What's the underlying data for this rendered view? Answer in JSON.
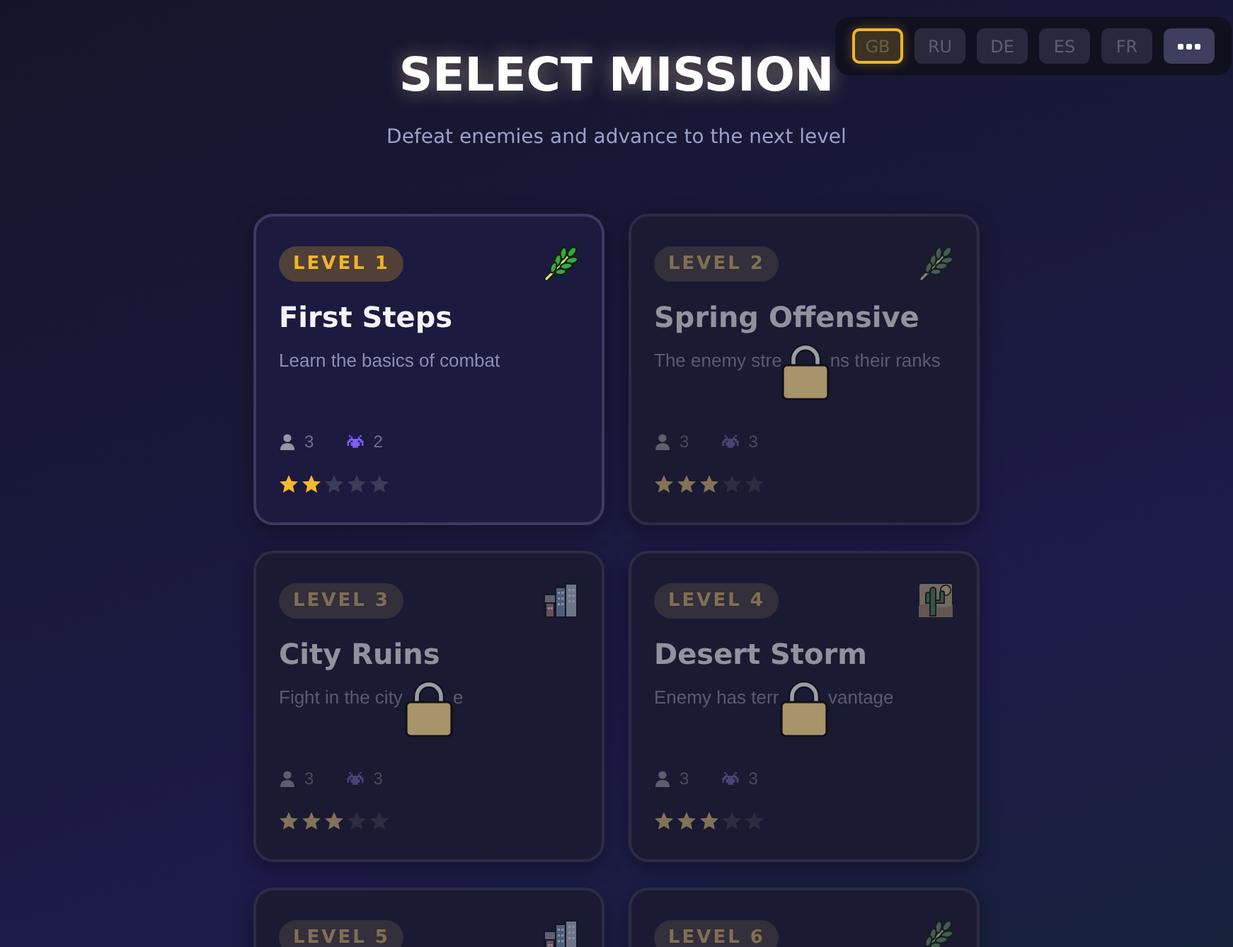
{
  "language_bar": {
    "languages": [
      {
        "label": "GB",
        "selected": true
      },
      {
        "label": "RU",
        "selected": false
      },
      {
        "label": "DE",
        "selected": false
      },
      {
        "label": "ES",
        "selected": false
      },
      {
        "label": "FR",
        "selected": false
      }
    ]
  },
  "header": {
    "title": "SELECT MISSION",
    "subtitle": "Defeat enemies and advance to the next level"
  },
  "missions": [
    {
      "level": "LEVEL 1",
      "kind": "forest",
      "locked": false,
      "title": "First Steps",
      "description": [
        "Learn the basics of combat"
      ],
      "units": "3",
      "enemies": "2",
      "stars": 2
    },
    {
      "level": "LEVEL 2",
      "kind": "forest",
      "locked": true,
      "title": "Spring Offensive",
      "description": [
        "The enemy stre",
        "ns their ranks"
      ],
      "units": "3",
      "enemies": "3",
      "stars": 3
    },
    {
      "level": "LEVEL 3",
      "kind": "city",
      "locked": true,
      "title": "City Ruins",
      "description": [
        "Fight in the city",
        "e"
      ],
      "units": "3",
      "enemies": "3",
      "stars": 3
    },
    {
      "level": "LEVEL 4",
      "kind": "desert",
      "locked": true,
      "title": "Desert Storm",
      "description": [
        "Enemy has terr",
        "vantage"
      ],
      "units": "3",
      "enemies": "3",
      "stars": 3
    },
    {
      "level": "LEVEL 5",
      "kind": "city",
      "locked": true
    },
    {
      "level": "LEVEL 6",
      "kind": "forest",
      "locked": true
    }
  ]
}
